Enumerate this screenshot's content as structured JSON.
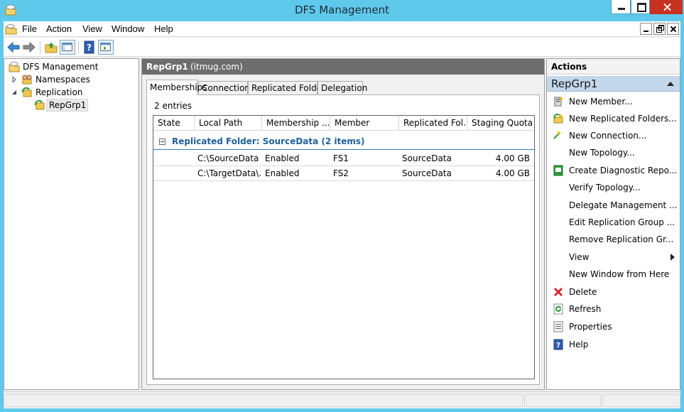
{
  "window": {
    "title": "DFS Management"
  },
  "menu": {
    "file": "File",
    "action": "Action",
    "view": "View",
    "window": "Window",
    "help": "Help"
  },
  "toolbar": {
    "icons": [
      "back-arrow-icon",
      "forward-arrow-icon",
      "up-folder-icon",
      "show-hide-tree-icon",
      "help-icon",
      "show-hide-action-pane-icon"
    ]
  },
  "tree": {
    "root": "DFS Management",
    "namespaces": "Namespaces",
    "replication": "Replication",
    "repgrp": "RepGrp1"
  },
  "center": {
    "title": "RepGrp1",
    "subtitle": "(itmug.com)",
    "tabs": [
      "Memberships",
      "Connections",
      "Replicated Folders",
      "Delegation"
    ],
    "active_tab": "Memberships",
    "entry_count": "2 entries",
    "columns": [
      "State",
      "Local Path",
      "Membership ...",
      "Member",
      "Replicated Fol...",
      "Staging Quota"
    ],
    "group_label": "Replicated Folder: SourceData (2 items)",
    "rows": [
      {
        "state": "",
        "local_path": "C:\\SourceData",
        "membership": "Enabled",
        "member": "FS1",
        "replicated_folder": "SourceData",
        "staging_quota": "4.00 GB"
      },
      {
        "state": "",
        "local_path": "C:\\TargetData\\...",
        "membership": "Enabled",
        "member": "FS2",
        "replicated_folder": "SourceData",
        "staging_quota": "4.00 GB"
      }
    ]
  },
  "actions": {
    "title": "Actions",
    "section": "RepGrp1",
    "items": [
      {
        "label": "New Member...",
        "icon": "new-member-icon"
      },
      {
        "label": "New Replicated Folders...",
        "icon": "new-replicated-folders-icon"
      },
      {
        "label": "New Connection...",
        "icon": "new-connection-icon"
      },
      {
        "label": "New Topology...",
        "icon": ""
      },
      {
        "label": "Create Diagnostic Repo...",
        "icon": "diagnostic-report-icon"
      },
      {
        "label": "Verify Topology...",
        "icon": ""
      },
      {
        "label": "Delegate Management ...",
        "icon": ""
      },
      {
        "label": "Edit Replication Group ...",
        "icon": ""
      },
      {
        "label": "Remove Replication Gr...",
        "icon": ""
      },
      {
        "label": "View",
        "icon": ""
      },
      {
        "label": "New Window from Here",
        "icon": ""
      },
      {
        "label": "Delete",
        "icon": "delete-icon"
      },
      {
        "label": "Refresh",
        "icon": "refresh-icon"
      },
      {
        "label": "Properties",
        "icon": "properties-icon"
      },
      {
        "label": "Help",
        "icon": "help-icon"
      }
    ]
  },
  "colors": {
    "titlebar": "#5fc9ec",
    "close_button": "#c7311f",
    "group_label": "#1f5f98",
    "actions_section": "#c3d7ea",
    "center_header": "#6d6d6d"
  }
}
